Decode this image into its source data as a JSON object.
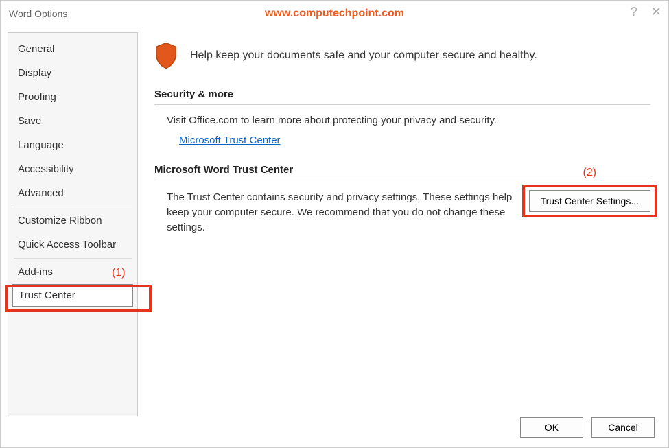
{
  "window": {
    "title": "Word Options",
    "watermark_url": "www.computechpoint.com"
  },
  "sidebar": {
    "items": [
      "General",
      "Display",
      "Proofing",
      "Save",
      "Language",
      "Accessibility",
      "Advanced",
      "Customize Ribbon",
      "Quick Access Toolbar",
      "Add-ins",
      "Trust Center"
    ],
    "selected_index": 10
  },
  "annotations": {
    "one": "(1)",
    "two": "(2)"
  },
  "hero": {
    "text": "Help keep your documents safe and your computer secure and healthy."
  },
  "section_security": {
    "heading": "Security & more",
    "text": "Visit Office.com to learn more about protecting your privacy and security.",
    "link_label": "Microsoft Trust Center"
  },
  "section_trustcenter": {
    "heading": "Microsoft Word Trust Center",
    "text": "The Trust Center contains security and privacy settings. These settings help keep your computer secure. We recommend that you do not change these settings.",
    "button_label": "Trust Center Settings..."
  },
  "footer": {
    "ok": "OK",
    "cancel": "Cancel"
  }
}
